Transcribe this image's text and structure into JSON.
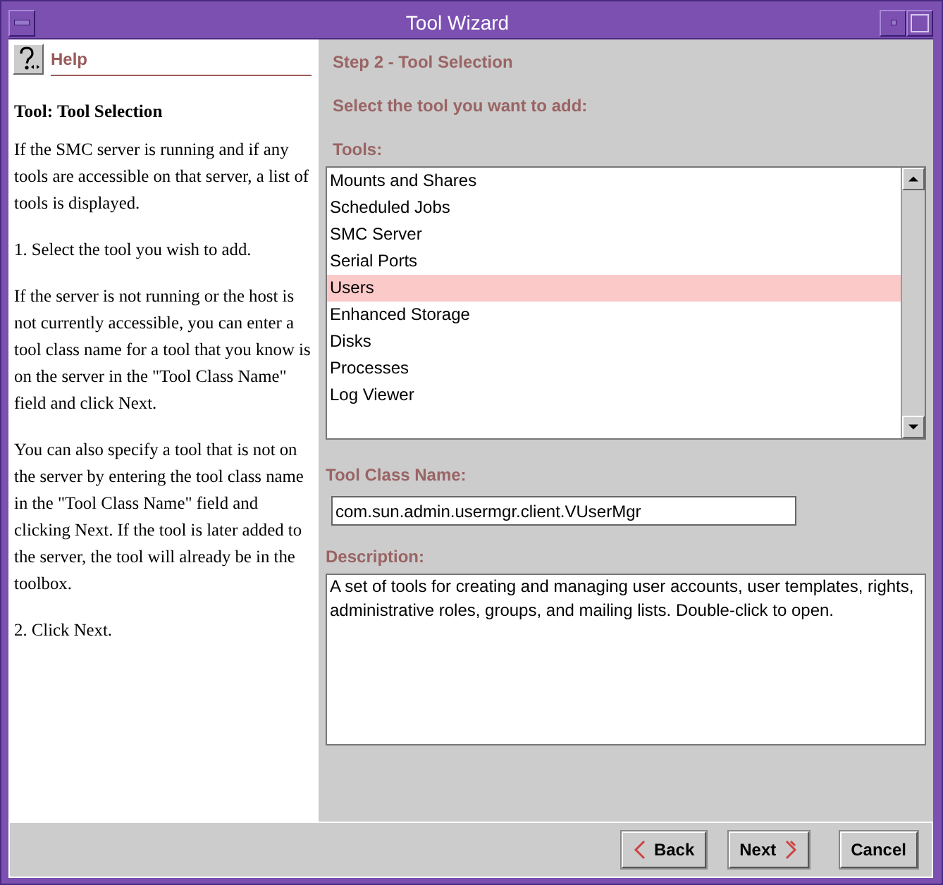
{
  "window": {
    "title": "Tool Wizard"
  },
  "help": {
    "title": "Help",
    "heading": "Tool: Tool Selection",
    "paragraphs": [
      "If the SMC server is running and if any tools are accessible on that server, a list of tools is displayed.",
      "1. Select the tool you wish to add.",
      "If the server is not running or the host is not currently accessible, you can enter a tool class name for a tool that you know is on the server in the \"Tool Class Name\" field and click Next.",
      "You can also specify a tool that is not on the server by entering the tool class name in the \"Tool Class Name\" field and clicking Next. If the tool is later added to the server, the tool will already be in the toolbox.",
      "2. Click Next."
    ]
  },
  "step": {
    "title": "Step 2 - Tool Selection",
    "instruction": "Select the tool you want to add:",
    "tools_label": "Tools:",
    "tools": [
      {
        "label": "Mounts and Shares",
        "selected": false
      },
      {
        "label": "Scheduled Jobs",
        "selected": false
      },
      {
        "label": "SMC Server",
        "selected": false
      },
      {
        "label": "Serial Ports",
        "selected": false
      },
      {
        "label": "Users",
        "selected": true
      },
      {
        "label": "Enhanced Storage",
        "selected": false
      },
      {
        "label": "Disks",
        "selected": false
      },
      {
        "label": "Processes",
        "selected": false
      },
      {
        "label": "Log Viewer",
        "selected": false
      }
    ],
    "class_name_label": "Tool Class Name:",
    "class_name": "com.sun.admin.usermgr.client.VUserMgr",
    "description_label": "Description:",
    "description": "A set of tools for creating and managing user accounts, user templates, rights, administrative roles, groups, and mailing lists. Double-click to open."
  },
  "buttons": [
    {
      "label": "Back",
      "kind": "back"
    },
    {
      "label": "Next",
      "kind": "next"
    },
    {
      "label": "Cancel",
      "kind": "cancel"
    }
  ]
}
